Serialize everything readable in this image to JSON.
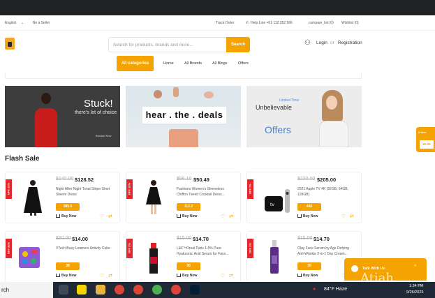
{
  "topbar": {
    "language": "English",
    "be_seller": "Be a Seller",
    "track_order": "Track Order",
    "helpline": "Help Line +01 112 352 566",
    "compare": "compare_list (0)",
    "wishlist": "Wishlist (0)"
  },
  "header": {
    "search_placeholder": "Search for products, brands and more...",
    "search_button": "Search",
    "login": "Login",
    "or": "or",
    "registration": "Registration"
  },
  "nav": {
    "all_categories": "All categories",
    "links": [
      "Home",
      "All Brands",
      "All Blogs",
      "Offers"
    ]
  },
  "banners": {
    "b1_big": "Stuck!",
    "b1_small": "there's lot of choice",
    "b1_cta": "Browse Now",
    "b2_text": "hear . the . deals",
    "b3_limited": "Limited Time",
    "b3_unbelievable": "Unbelievable",
    "b3_offers": "Offers"
  },
  "flash_sale": {
    "title": "Flash Sale",
    "buy_now": "Buy Now",
    "products": [
      {
        "badge": "OFF 10%",
        "old": "$142.00",
        "new": "$128.52",
        "name": "Night After Night Tonal Stripe Short Sleeve Dress",
        "points": "285.6"
      },
      {
        "badge": "OFF 10%",
        "old": "$56.10",
        "new": "$50.49",
        "name": "Fashions Women's Sleeveless Chiffon Tiered Cocktail Dress...",
        "points": "112.2"
      },
      {
        "badge": "OFF 7%",
        "old": "$220.00",
        "new": "$205.00",
        "name": "2021 Apple TV 4K (32GB, 64GB, 128GB)",
        "points": "440"
      },
      {
        "badge": "OFF 30%",
        "old": "$20.00",
        "new": "$14.00",
        "name": "VTech Busy Learners Activity Cube",
        "points": "38"
      },
      {
        "badge": "OFF 2%",
        "old": "$15.00",
        "new": "$14.70",
        "name": "L&€™Oreal Paris 1.5% Pure Hyaluronic Acid Serum for Face...",
        "points": "30"
      },
      {
        "badge": "OFF 2%",
        "old": "$15.00",
        "new": "$14.70",
        "name": "Olay Face Serum by Age Defying Anti-Wrinkle 2-in-1 Day Cream...",
        "points": "30"
      }
    ]
  },
  "side_widget": {
    "label": "0 Item",
    "value": "$0.00"
  },
  "chat": {
    "label": "Talk With Us"
  },
  "watermark": "Atiah",
  "taskbar": {
    "search": "rch",
    "weather": "84°F  Haze",
    "time": "1:34 PM",
    "date": "9/26/2023"
  },
  "colors": {
    "accent": "#f5a300",
    "badge": "#e4272d"
  }
}
